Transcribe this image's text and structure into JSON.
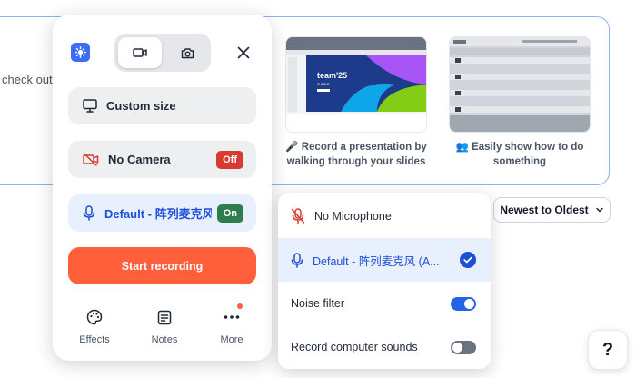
{
  "background": {
    "intro_text": "check out",
    "cards": [
      {
        "caption": "🎤 Record a presentation by walking through your slides",
        "slide_title": "team'25",
        "slide_sub": "SUMMIT"
      },
      {
        "caption": "👥 Easily show how to do something"
      }
    ],
    "sort": {
      "label": "Newest to Oldest"
    },
    "help": {
      "label": "?"
    }
  },
  "recorder": {
    "modes": {
      "selected": "video"
    },
    "rows": {
      "size": {
        "label": "Custom size"
      },
      "camera": {
        "label": "No Camera",
        "badge": "Off"
      },
      "microphone": {
        "label": "Default - 阵列麦克风 (A...",
        "badge": "On"
      }
    },
    "start_label": "Start recording",
    "tools": [
      {
        "label": "Effects"
      },
      {
        "label": "Notes"
      },
      {
        "label": "More"
      }
    ]
  },
  "mic_menu": {
    "items": [
      {
        "label": "No Microphone"
      },
      {
        "label": "Default - 阵列麦克风 (A...",
        "selected": true
      }
    ],
    "toggles": [
      {
        "label": "Noise filter",
        "on": true
      },
      {
        "label": "Record computer sounds",
        "on": false
      }
    ]
  },
  "colors": {
    "accent": "#1d4ed8",
    "start": "#ff5f3b",
    "off_badge": "#d63b2f",
    "on_badge": "#2e7d4f",
    "card_border": "#8fb3f0"
  }
}
